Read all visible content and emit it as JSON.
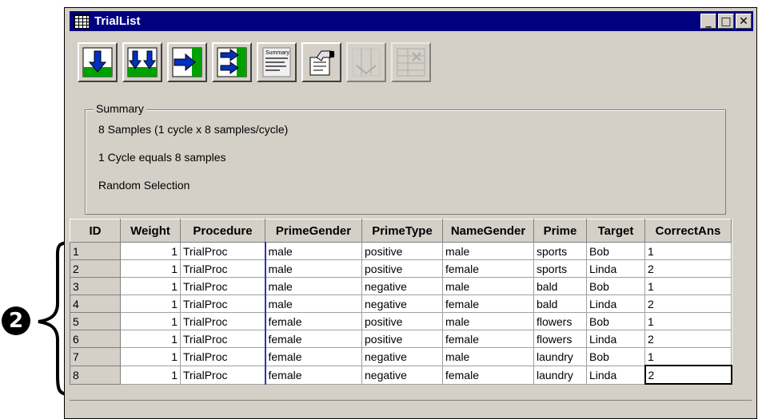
{
  "callout": {
    "number": "2"
  },
  "window": {
    "title": "TrialList",
    "controls": {
      "minimize": "_",
      "maximize": "□",
      "close": "✕"
    }
  },
  "toolbar": {
    "buttons": [
      {
        "name": "add-level",
        "icon": "arrow-down-icon",
        "enabled": true
      },
      {
        "name": "add-multiple-levels",
        "icon": "double-arrow-down-icon",
        "enabled": true
      },
      {
        "name": "add-attribute",
        "icon": "arrow-right-icon",
        "enabled": true
      },
      {
        "name": "add-multiple-attributes",
        "icon": "double-arrow-right-icon",
        "enabled": true
      },
      {
        "name": "summary",
        "icon": "summary-icon",
        "label": "Summary",
        "enabled": true
      },
      {
        "name": "properties",
        "icon": "properties-icon",
        "enabled": true
      },
      {
        "name": "remove-level",
        "icon": "remove-level-icon",
        "enabled": false
      },
      {
        "name": "remove-attribute",
        "icon": "remove-attribute-icon",
        "enabled": false
      }
    ]
  },
  "summary": {
    "legend": "Summary",
    "lines": [
      "8 Samples (1 cycle x 8 samples/cycle)",
      "1 Cycle equals 8 samples",
      "Random Selection"
    ]
  },
  "grid": {
    "columns": [
      "ID",
      "Weight",
      "Procedure",
      "PrimeGender",
      "PrimeType",
      "NameGender",
      "Prime",
      "Target",
      "CorrectAns"
    ],
    "rows": [
      [
        "1",
        "1",
        "TrialProc",
        "male",
        "positive",
        "male",
        "sports",
        "Bob",
        "1"
      ],
      [
        "2",
        "1",
        "TrialProc",
        "male",
        "positive",
        "female",
        "sports",
        "Linda",
        "2"
      ],
      [
        "3",
        "1",
        "TrialProc",
        "male",
        "negative",
        "male",
        "bald",
        "Bob",
        "1"
      ],
      [
        "4",
        "1",
        "TrialProc",
        "male",
        "negative",
        "female",
        "bald",
        "Linda",
        "2"
      ],
      [
        "5",
        "1",
        "TrialProc",
        "female",
        "positive",
        "male",
        "flowers",
        "Bob",
        "1"
      ],
      [
        "6",
        "1",
        "TrialProc",
        "female",
        "positive",
        "female",
        "flowers",
        "Linda",
        "2"
      ],
      [
        "7",
        "1",
        "TrialProc",
        "female",
        "negative",
        "male",
        "laundry",
        "Bob",
        "1"
      ],
      [
        "8",
        "1",
        "TrialProc",
        "female",
        "negative",
        "female",
        "laundry",
        "Linda",
        "2"
      ]
    ]
  },
  "colors": {
    "titlebar": "#000080",
    "face": "#d4d0c8",
    "arrow_blue": "#0030c0",
    "arrow_green": "#00a000"
  }
}
